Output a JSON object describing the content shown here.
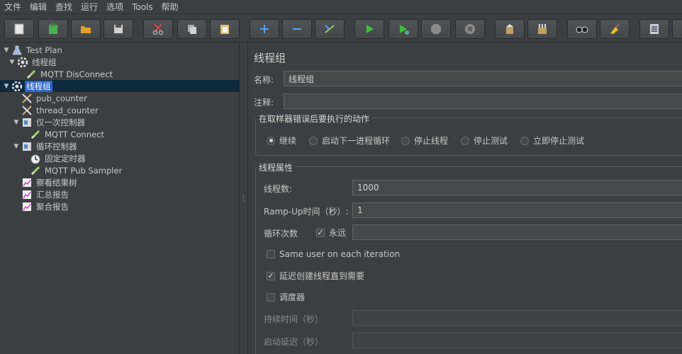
{
  "menu": [
    "文件",
    "编辑",
    "查找",
    "运行",
    "选项",
    "Tools",
    "帮助"
  ],
  "toolbar": {
    "buttons": [
      {
        "name": "new-icon",
        "color": "#e8e8e8"
      },
      {
        "name": "templates-icon",
        "color": "#4caf50"
      },
      {
        "name": "open-icon",
        "color": "#e0a030"
      },
      {
        "name": "save-icon",
        "color": "#d0d0d0"
      },
      {
        "name": "cut-icon",
        "color": "#e04040"
      },
      {
        "name": "copy-icon",
        "color": "#d0d0d0"
      },
      {
        "name": "paste-icon",
        "color": "#e0c070"
      },
      {
        "name": "expand-icon",
        "color": "#4fa3ff"
      },
      {
        "name": "collapse-icon",
        "color": "#4fa3ff"
      },
      {
        "name": "toggle-icon",
        "color": "#8fd060"
      },
      {
        "name": "start-icon",
        "color": "#3cbf3c"
      },
      {
        "name": "start-no-pause-icon",
        "color": "#3cbf3c"
      },
      {
        "name": "stop-icon",
        "color": "#8a8a8a"
      },
      {
        "name": "shutdown-icon",
        "color": "#8a8a8a"
      },
      {
        "name": "clear-icon",
        "color": "#c0a060"
      },
      {
        "name": "clear-all-icon",
        "color": "#c0a060"
      },
      {
        "name": "search-icon",
        "color": "#d0d0d0"
      },
      {
        "name": "reset-search-icon",
        "color": "#f0c020"
      },
      {
        "name": "function-helper-icon",
        "color": "#d0d0d0"
      }
    ]
  },
  "tree": {
    "items": [
      {
        "label": "Test Plan",
        "depth": 0,
        "toggle": "▼",
        "icon": "test-plan-icon",
        "selected": false
      },
      {
        "label": "线程组",
        "depth": 1,
        "toggle": "▼",
        "icon": "thread-group-icon",
        "selected": false
      },
      {
        "label": "MQTT DisConnect",
        "depth": 2,
        "toggle": "",
        "icon": "sampler-icon",
        "selected": false
      },
      {
        "label": "线程组",
        "depth": 0,
        "toggle": "▼",
        "icon": "thread-group-icon",
        "selected": true
      },
      {
        "label": "pub_counter",
        "depth": 2,
        "toggle": "",
        "icon": "counter-icon",
        "selected": false
      },
      {
        "label": "thread_counter",
        "depth": 2,
        "toggle": "",
        "icon": "counter-icon",
        "selected": false
      },
      {
        "label": "仅一次控制器",
        "depth": 2,
        "toggle": "▼",
        "icon": "controller-icon",
        "selected": false
      },
      {
        "label": "MQTT Connect",
        "depth": 3,
        "toggle": "",
        "icon": "sampler-icon",
        "selected": false
      },
      {
        "label": "循环控制器",
        "depth": 2,
        "toggle": "▼",
        "icon": "controller-icon",
        "selected": false
      },
      {
        "label": "固定定时器",
        "depth": 3,
        "toggle": "",
        "icon": "timer-icon",
        "selected": false
      },
      {
        "label": "MQTT Pub Sampler",
        "depth": 3,
        "toggle": "",
        "icon": "sampler-icon",
        "selected": false
      },
      {
        "label": "察看结果树",
        "depth": 2,
        "toggle": "",
        "icon": "listener-icon",
        "selected": false
      },
      {
        "label": "汇总报告",
        "depth": 2,
        "toggle": "",
        "icon": "listener-icon",
        "selected": false
      },
      {
        "label": "聚合报告",
        "depth": 2,
        "toggle": "",
        "icon": "listener-icon",
        "selected": false
      }
    ]
  },
  "main": {
    "title": "线程组",
    "name_label": "名称:",
    "name_value": "线程组",
    "comment_label": "注释:",
    "comment_value": "",
    "error_group_title": "在取样器错误后要执行的动作",
    "error_actions": [
      {
        "label": "继续",
        "selected": true
      },
      {
        "label": "启动下一进程循环",
        "selected": false
      },
      {
        "label": "停止线程",
        "selected": false
      },
      {
        "label": "停止测试",
        "selected": false
      },
      {
        "label": "立即停止测试",
        "selected": false
      }
    ],
    "props_group_title": "线程属性",
    "threads_label": "线程数:",
    "threads_value": "1000",
    "rampup_label": "Ramp-Up时间（秒）:",
    "rampup_value": "1",
    "loop_label": "循环次数",
    "forever_label": "永远",
    "forever_checked": true,
    "loop_value": "",
    "same_user_label": "Same user on each iteration",
    "same_user_checked": false,
    "delay_label": "延迟创建线程直到需要",
    "delay_checked": true,
    "scheduler_label": "调度器",
    "scheduler_checked": false,
    "duration_label": "持续时间（秒）",
    "duration_value": "",
    "startup_delay_label": "启动延迟（秒）",
    "startup_delay_value": ""
  }
}
